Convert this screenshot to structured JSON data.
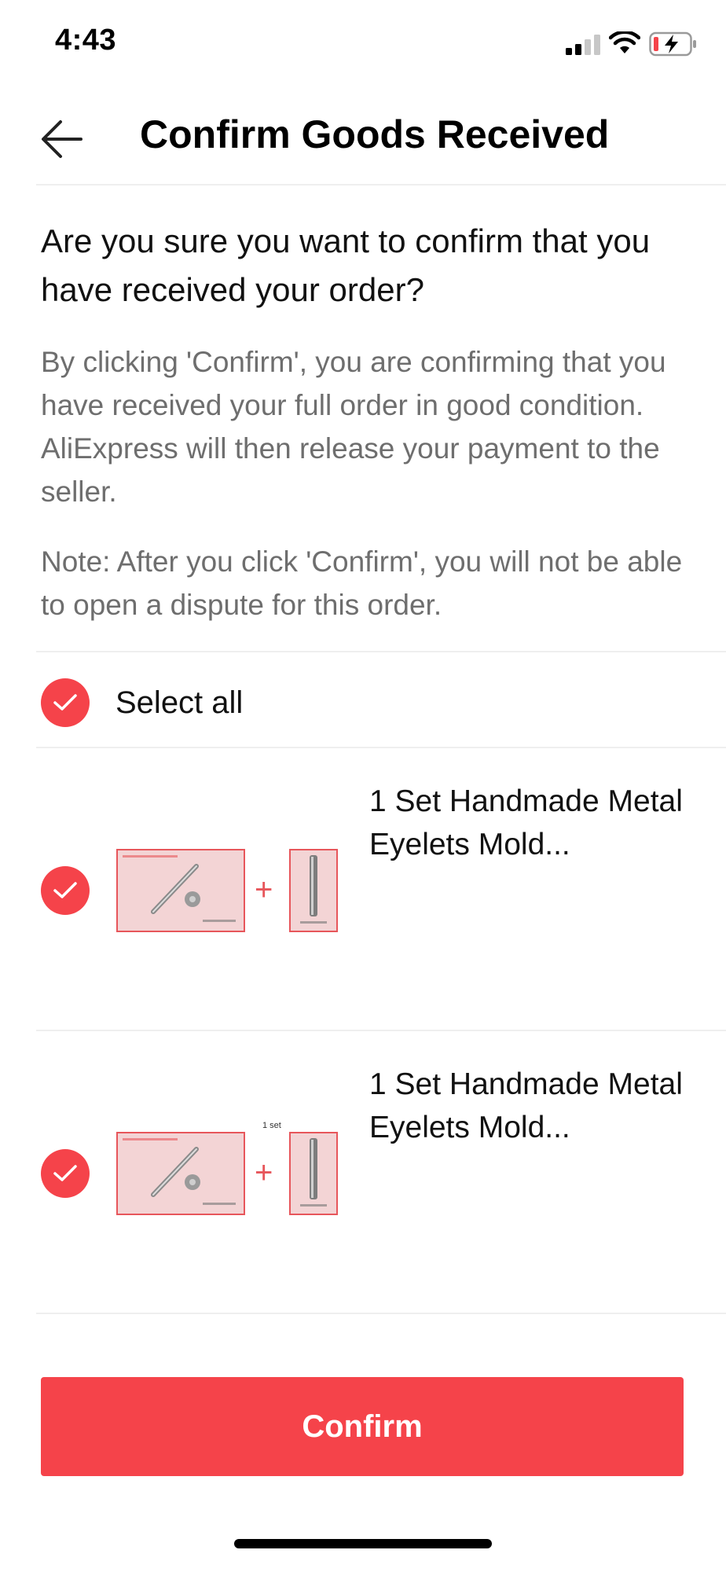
{
  "status_bar": {
    "time": "4:43"
  },
  "header": {
    "back_icon": "arrow-left-icon",
    "title": "Confirm Goods Received"
  },
  "content": {
    "question": "Are you sure you want to confirm that you have received your order?",
    "explanation": "By clicking 'Confirm', you are confirming that you have received your full order in good condition. AliExpress will then release your payment to the seller.",
    "note": "Note: After you click 'Confirm', you will not be able to open a dispute for this order."
  },
  "select_all": {
    "label": "Select all",
    "checked": true
  },
  "products": [
    {
      "title": "1 Set Handmade Metal Eyelets Mold...",
      "checked": true
    },
    {
      "title": "1 Set Handmade Metal Eyelets Mold...",
      "checked": true,
      "image_label": "1 set"
    }
  ],
  "confirm_button": {
    "label": "Confirm"
  },
  "colors": {
    "accent": "#f5434a",
    "secondary_text": "#6e6e6e",
    "divider": "#efefef"
  }
}
